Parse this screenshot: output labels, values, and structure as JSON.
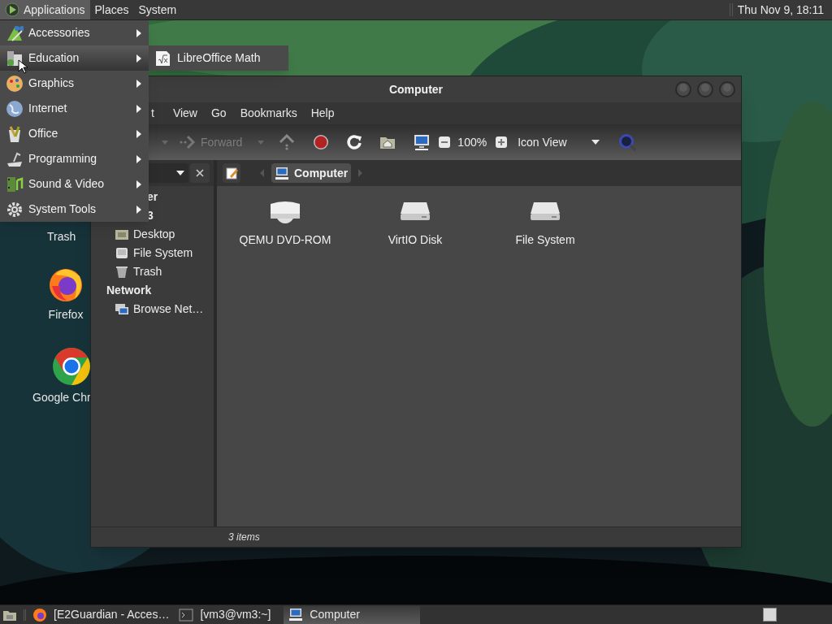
{
  "top_panel": {
    "menus": [
      {
        "label": "Applications",
        "selected": true
      },
      {
        "label": "Places",
        "selected": false
      },
      {
        "label": "System",
        "selected": false
      }
    ],
    "clock": "Thu Nov 9, 18:11"
  },
  "desktop_icons": [
    {
      "label": "Trash",
      "kind": "label_only"
    },
    {
      "label": "Firefox",
      "kind": "firefox"
    },
    {
      "label": "Google Chr",
      "kind": "chrome"
    }
  ],
  "window": {
    "title": "Computer",
    "menubar": [
      "t",
      "View",
      "Go",
      "Bookmarks",
      "Help"
    ],
    "toolbar": {
      "forward": {
        "label": "Forward",
        "disabled": true
      },
      "zoom": "100%",
      "view_mode": "Icon View"
    },
    "pathbar": {
      "items": [
        {
          "label": "Computer",
          "selected": true
        }
      ]
    },
    "sidebar": [
      {
        "kind": "fragment",
        "label": "er"
      },
      {
        "kind": "fragment",
        "label": "3"
      },
      {
        "kind": "place",
        "label": "Desktop"
      },
      {
        "kind": "place",
        "label": "File System"
      },
      {
        "kind": "place",
        "label": "Trash"
      },
      {
        "kind": "heading",
        "label": "Network"
      },
      {
        "kind": "place",
        "label": "Browse Net…"
      }
    ],
    "items": [
      {
        "label": "QEMU DVD-ROM",
        "kind": "optical"
      },
      {
        "label": "VirtIO Disk",
        "kind": "disk"
      },
      {
        "label": "File System",
        "kind": "disk"
      }
    ],
    "status": "3 items"
  },
  "applications_menu": {
    "items": [
      {
        "label": "Accessories",
        "selected": false
      },
      {
        "label": "Education",
        "selected": true
      },
      {
        "label": "Graphics",
        "selected": false
      },
      {
        "label": "Internet",
        "selected": false
      },
      {
        "label": "Office",
        "selected": false
      },
      {
        "label": "Programming",
        "selected": false
      },
      {
        "label": "Sound & Video",
        "selected": false
      },
      {
        "label": "System Tools",
        "selected": false
      }
    ],
    "submenu": {
      "items": [
        {
          "label": "LibreOffice Math"
        }
      ]
    }
  },
  "taskbar": {
    "items": [
      {
        "label": "[E2Guardian - Acces…",
        "kind": "firefox",
        "selected": false
      },
      {
        "label": "[vm3@vm3:~]",
        "kind": "terminal",
        "selected": false
      },
      {
        "label": "Computer",
        "kind": "computer",
        "selected": true
      }
    ]
  }
}
